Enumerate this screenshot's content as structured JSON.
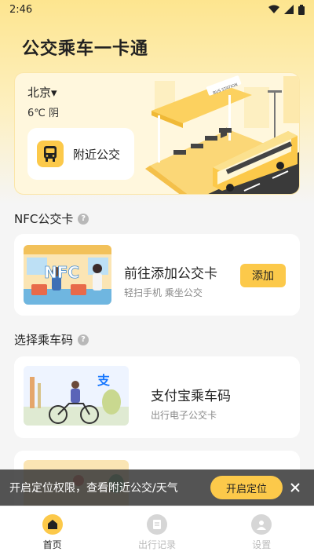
{
  "status_bar": {
    "time": "2:46"
  },
  "app_title": "公交乘车一卡通",
  "hero": {
    "city": "北京▾",
    "weather": "6℃ 阴",
    "nearby_label": "附近公交",
    "station_sign": "BUS STATION"
  },
  "nfc_section": {
    "title": "NFC公交卡",
    "card_title": "前往添加公交卡",
    "card_sub": "轻扫手机  乘坐公交",
    "thumb_text": "NFC",
    "add_label": "添加"
  },
  "code_section": {
    "title": "选择乘车码",
    "alipay_title": "支付宝乘车码",
    "alipay_sub": "出行电子公交卡",
    "alipay_logo": "支"
  },
  "toast": {
    "text": "开启定位权限，查看附近公交/天气",
    "button_label": "开启定位"
  },
  "bottom_nav": {
    "items": [
      {
        "label": "首页",
        "icon": "home-icon",
        "active": true
      },
      {
        "label": "出行记录",
        "icon": "record-icon",
        "active": false
      },
      {
        "label": "设置",
        "icon": "profile-icon",
        "active": false
      }
    ]
  },
  "colors": {
    "accent": "#fcc94a",
    "background": "#f5f5f5"
  }
}
